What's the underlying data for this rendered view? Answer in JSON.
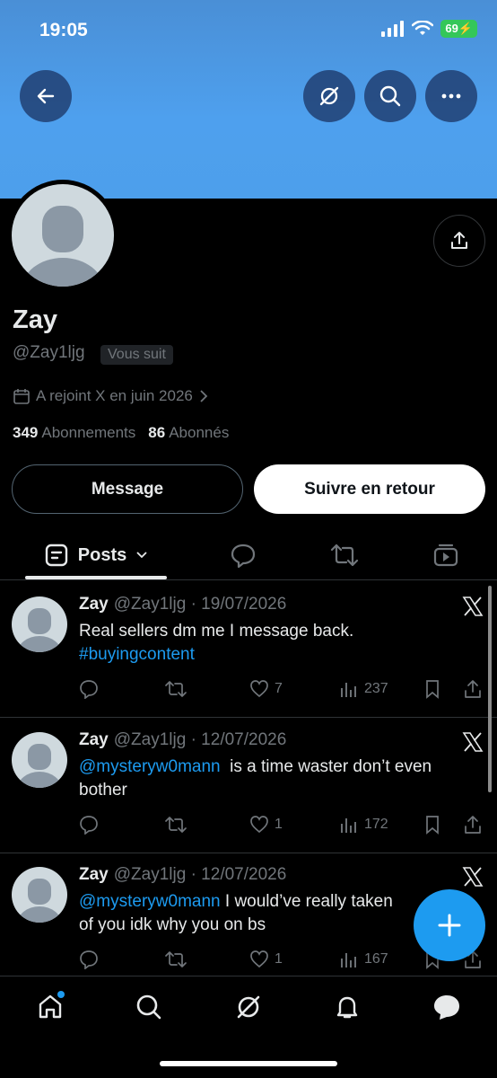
{
  "status_bar": {
    "time": "19:05",
    "battery": "69"
  },
  "colors": {
    "banner": "#4d9feb",
    "accent": "#1d9bf0",
    "battery": "#34c759"
  },
  "header": {
    "icons": [
      "back-arrow-icon",
      "grok-icon",
      "search-icon",
      "more-icon"
    ]
  },
  "profile": {
    "name": "Zay",
    "handle": "@Zay1ljg",
    "follows_you": "Vous suit",
    "joined": "A rejoint X en juin 2026",
    "following_count": "349",
    "following_label": "Abonnements",
    "followers_count": "86",
    "followers_label": "Abonnés"
  },
  "buttons": {
    "message": "Message",
    "follow_back": "Suivre en retour"
  },
  "tabs": {
    "posts": "Posts"
  },
  "posts": [
    {
      "name": "Zay",
      "handle": "@Zay1ljg",
      "date": "· 19/07/2026",
      "text": "Real sellers dm me I message back.",
      "hashtag": "#buyingcontent",
      "replies": "",
      "likes": "7",
      "views": "237"
    },
    {
      "name": "Zay",
      "handle": "@Zay1ljg",
      "date": "· 12/07/2026",
      "mention": "@mysteryw0mann",
      "text": "is a time waster don’t even bother",
      "likes": "1",
      "views": "172"
    },
    {
      "name": "Zay",
      "handle": "@Zay1ljg",
      "date": "· 12/07/2026",
      "mention": "@mysteryw0mann",
      "text": "I would’ve really taken",
      "text2": "of you idk why you on bs",
      "likes": "1",
      "views": "167"
    }
  ]
}
